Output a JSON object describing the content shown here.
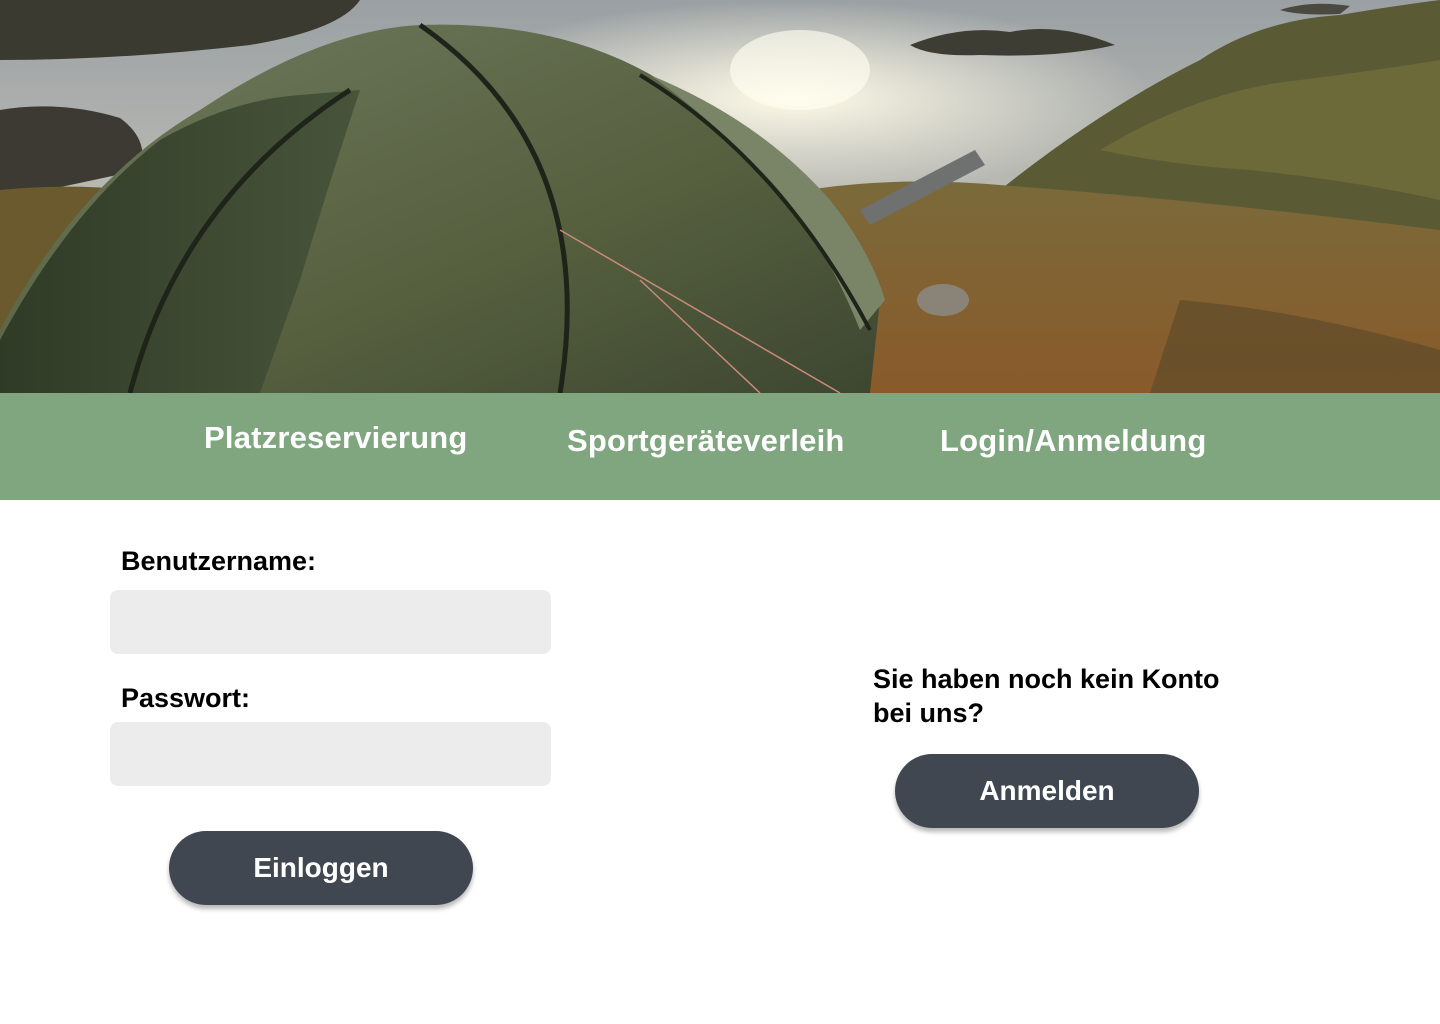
{
  "hero": {
    "image": "camping-tent-lake-photo"
  },
  "nav": {
    "items": [
      {
        "label": "Platzreservierung"
      },
      {
        "label": "Sportgeräteverleih"
      },
      {
        "label": "Login/Anmeldung"
      }
    ]
  },
  "login": {
    "username_label": "Benutzername:",
    "username_value": "",
    "password_label": "Passwort:",
    "password_value": "",
    "submit_label": "Einloggen"
  },
  "register": {
    "prompt": "Sie haben noch kein Konto bei uns?",
    "button_label": "Anmelden"
  },
  "colors": {
    "nav_background": "#7fa67e",
    "button_background": "#404750",
    "input_background": "#ececec"
  }
}
